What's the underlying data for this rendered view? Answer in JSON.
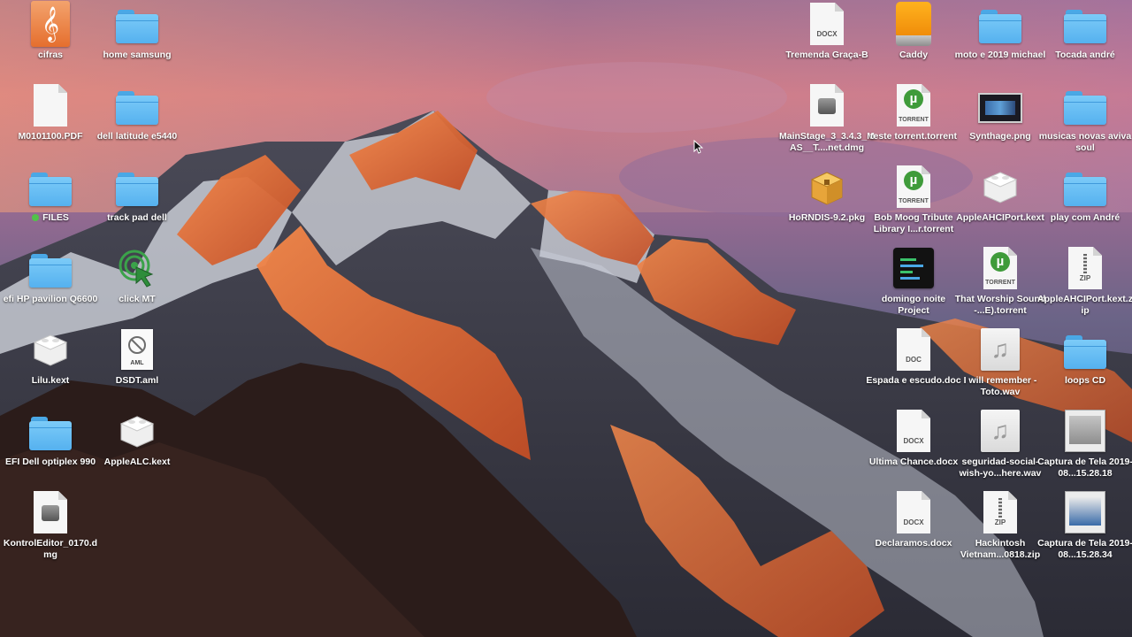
{
  "desktop": {
    "icons": [
      {
        "label": "cifras",
        "type": "cifras"
      },
      {
        "label": "home samsung",
        "type": "folder"
      },
      {
        "label": "M0101100.PDF",
        "type": "pdf"
      },
      {
        "label": "dell latitude e5440",
        "type": "folder"
      },
      {
        "label": "FILES",
        "type": "folder",
        "tag": "green"
      },
      {
        "label": "track pad dell",
        "type": "folder"
      },
      {
        "label": "efi HP pavilion Q6600",
        "type": "folder"
      },
      {
        "label": "click MT",
        "type": "clickmt"
      },
      {
        "label": "Lilu.kext",
        "type": "kext"
      },
      {
        "label": "DSDT.aml",
        "type": "aml",
        "badge": "AML"
      },
      {
        "label": "EFI Dell optiplex 990",
        "type": "folder"
      },
      {
        "label": "AppleALC.kext",
        "type": "kext"
      },
      {
        "label": "KontrolEditor_0170.dmg",
        "type": "dmg"
      },
      {
        "label": "Tremenda Graça-B",
        "type": "docx",
        "badge": "DOCX"
      },
      {
        "label": "Caddy",
        "type": "caddy"
      },
      {
        "label": "moto e 2019 michael",
        "type": "folder"
      },
      {
        "label": "Tocada andré",
        "type": "folder"
      },
      {
        "label": "MainStage_3_3.4.3_MAS__T....net.dmg",
        "type": "dmg"
      },
      {
        "label": "teste torrent.torrent",
        "type": "torrent",
        "badge": "TORRENT"
      },
      {
        "label": "Synthage.png",
        "type": "png"
      },
      {
        "label": "musicas novas aviva soul",
        "type": "folder"
      },
      {
        "label": "HoRNDIS-9.2.pkg",
        "type": "pkg"
      },
      {
        "label": "Bob Moog Tribute Library I...r.torrent",
        "type": "torrent",
        "badge": "TORRENT"
      },
      {
        "label": "AppleAHCIPort.kext",
        "type": "kext"
      },
      {
        "label": "play com André",
        "type": "folder"
      },
      {
        "label": "domingo noite Project",
        "type": "terminal"
      },
      {
        "label": "That Worship Sound -...E).torrent",
        "type": "torrent",
        "badge": "TORRENT"
      },
      {
        "label": "AppleAHCIPort.kext.zip",
        "type": "zip",
        "badge": "ZIP"
      },
      {
        "label": "Espada e escudo.doc",
        "type": "doc",
        "badge": "DOC"
      },
      {
        "label": "I will remember - Toto.wav",
        "type": "music"
      },
      {
        "label": "loops CD",
        "type": "folder"
      },
      {
        "label": "Ultima Chance.docx",
        "type": "docx",
        "badge": "DOCX"
      },
      {
        "label": "seguridad-social-wish-yo...here.wav",
        "type": "music"
      },
      {
        "label": "Captura de Tela 2019-08...15.28.18",
        "type": "capture"
      },
      {
        "label": "Declaramos.docx",
        "type": "docx",
        "badge": "DOCX"
      },
      {
        "label": "Hackintosh Vietnam...0818.zip",
        "type": "zip",
        "badge": "ZIP"
      },
      {
        "label": "Captura de Tela 2019-08...15.28.34",
        "type": "capture"
      }
    ]
  }
}
